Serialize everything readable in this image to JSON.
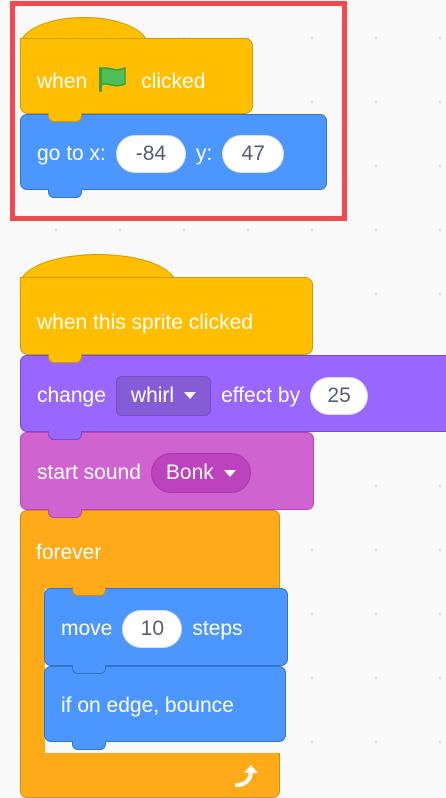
{
  "script1": {
    "hat": {
      "when": "when",
      "clicked": "clicked",
      "icon": "green-flag-icon"
    },
    "goto": {
      "label_x": "go to x:",
      "x": "-84",
      "label_y": "y:",
      "y": "47"
    }
  },
  "script2": {
    "hat": {
      "label": "when this sprite clicked"
    },
    "effect": {
      "change": "change",
      "effect_name": "whirl",
      "effect_by": "effect by",
      "amount": "25"
    },
    "sound": {
      "label": "start sound",
      "sound_name": "Bonk"
    },
    "forever": {
      "label": "forever",
      "icon": "loop-arrow-icon"
    },
    "move": {
      "label": "move",
      "steps_value": "10",
      "steps": "steps"
    },
    "bounce": {
      "label": "if on edge, bounce"
    }
  },
  "colors": {
    "events": "#ffbf00",
    "motion": "#4c97ff",
    "looks": "#9966ff",
    "sound": "#cf63cf",
    "control": "#ffab19",
    "highlight": "#f04a4f"
  }
}
